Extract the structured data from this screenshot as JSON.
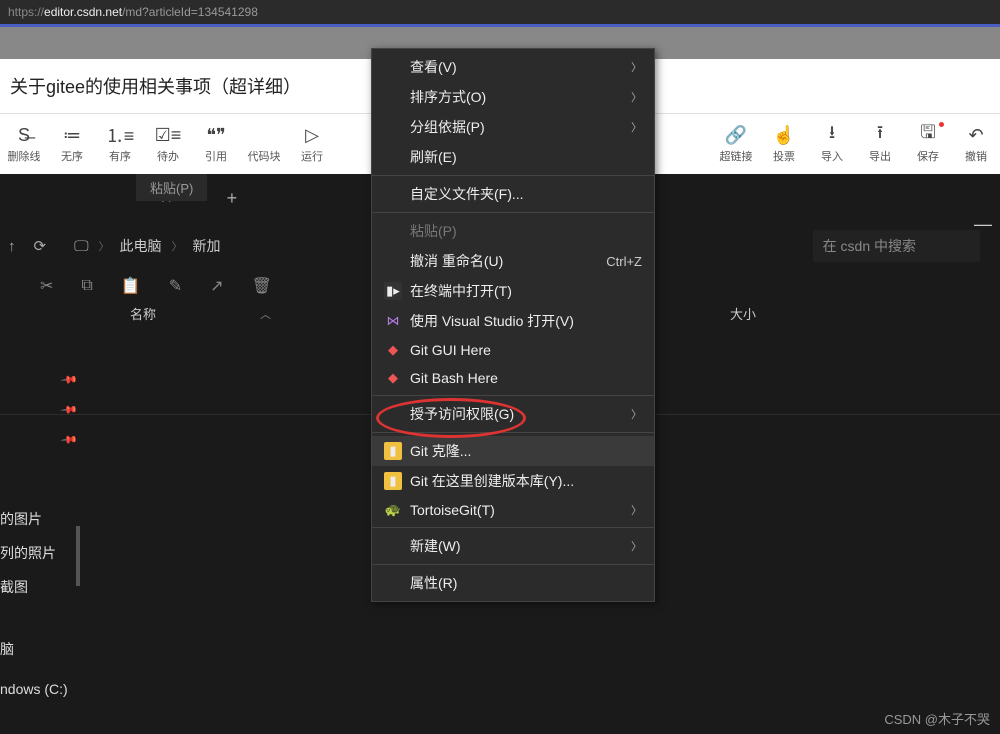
{
  "url": {
    "protocol": "https://",
    "domain": "editor.csdn.net",
    "path": "/md?articleId=134541298"
  },
  "title": "关于gitee的使用相关事项（超详细）",
  "toolbar": [
    {
      "icon": "S̶",
      "label": "删除线"
    },
    {
      "icon": "≔",
      "label": "无序"
    },
    {
      "icon": "⒈≡",
      "label": "有序"
    },
    {
      "icon": "☑≡",
      "label": "待办"
    },
    {
      "icon": "❝❞",
      "label": "引用"
    },
    {
      "icon": "</>",
      "label": "代码块"
    },
    {
      "icon": "▷",
      "label": "运行"
    }
  ],
  "toolbar_right": [
    {
      "icon": "🔗",
      "label": "超链接"
    },
    {
      "icon": "☝",
      "label": "投票"
    },
    {
      "icon": "⭳",
      "label": "导入"
    },
    {
      "icon": "⭱",
      "label": "导出"
    },
    {
      "icon": "🖫",
      "label": "保存"
    },
    {
      "icon": "↶",
      "label": "撤销"
    }
  ],
  "paste_hint": "粘贴(P)",
  "explorer": {
    "breadcrumb": [
      "此电脑",
      "新加"
    ],
    "search_placeholder": "在 csdn 中搜索",
    "columns": {
      "name": "名称",
      "size": "大小"
    },
    "sidebar": [
      "的图片",
      "列的照片",
      "截图",
      "脑",
      "ndows (C:)"
    ]
  },
  "context_menu": [
    {
      "label": "查看(V)",
      "arrow": true
    },
    {
      "label": "排序方式(O)",
      "arrow": true
    },
    {
      "label": "分组依据(P)",
      "arrow": true
    },
    {
      "label": "刷新(E)"
    },
    {
      "sep": true
    },
    {
      "label": "自定义文件夹(F)..."
    },
    {
      "sep": true
    },
    {
      "label": "粘贴(P)",
      "disabled": true
    },
    {
      "label": "撤消 重命名(U)",
      "shortcut": "Ctrl+Z"
    },
    {
      "label": "在终端中打开(T)",
      "icon": "▮▸",
      "iconbg": "#333"
    },
    {
      "label": "使用 Visual Studio 打开(V)",
      "icon": "⋈",
      "iconcolor": "#b57ee5"
    },
    {
      "label": "Git GUI Here",
      "icon": "◆",
      "iconcolor": "#e55"
    },
    {
      "label": "Git Bash Here",
      "icon": "◆",
      "iconcolor": "#e55"
    },
    {
      "sep": true
    },
    {
      "label": "授予访问权限(G)",
      "arrow": true
    },
    {
      "sep": true
    },
    {
      "label": "Git 克隆...",
      "icon": "▮",
      "iconbg": "#f0c040",
      "highlighted": true
    },
    {
      "label": "Git 在这里创建版本库(Y)...",
      "icon": "▮",
      "iconbg": "#f0c040"
    },
    {
      "label": "TortoiseGit(T)",
      "icon": "🐢",
      "arrow": true
    },
    {
      "sep": true
    },
    {
      "label": "新建(W)",
      "arrow": true
    },
    {
      "sep": true
    },
    {
      "label": "属性(R)"
    }
  ],
  "watermark": "CSDN @木子不哭"
}
